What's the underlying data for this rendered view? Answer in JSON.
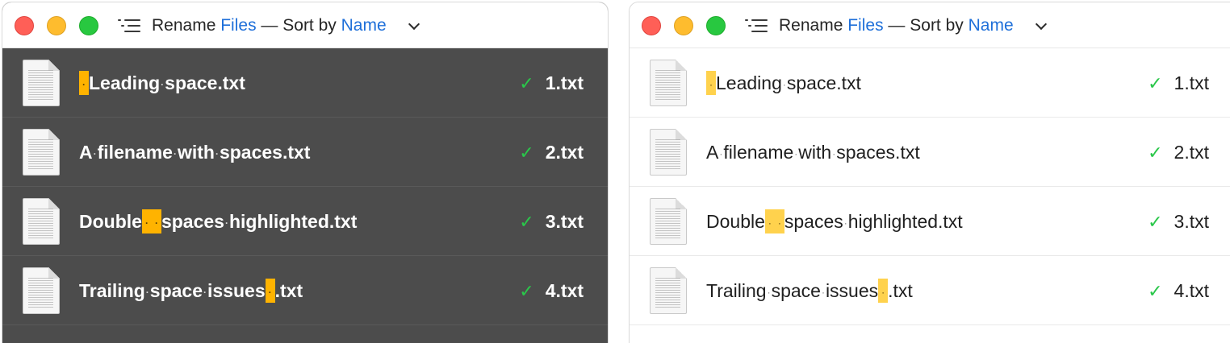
{
  "title": {
    "prefix": "Rename",
    "files": "Files",
    "middle": "— Sort by",
    "name": "Name"
  },
  "colors": {
    "highlight_dark": "#ffb300",
    "highlight_light": "#ffd24d",
    "accent": "#1e6fd9",
    "check": "#2ac74a"
  },
  "rows": [
    {
      "parts": [
        [
          "",
          true
        ],
        [
          "Leading",
          false
        ],
        [
          "",
          false
        ],
        [
          "space.txt",
          false
        ]
      ],
      "result": "1.txt"
    },
    {
      "parts": [
        [
          "A",
          false
        ],
        [
          "",
          false
        ],
        [
          "filename",
          false
        ],
        [
          "",
          false
        ],
        [
          "with",
          false
        ],
        [
          "",
          false
        ],
        [
          "spaces.txt",
          false
        ]
      ],
      "result": "2.txt"
    },
    {
      "parts": [
        [
          "Double",
          false
        ],
        [
          "",
          true
        ],
        [
          "",
          true
        ],
        [
          "spaces",
          false
        ],
        [
          "",
          false
        ],
        [
          "highlighted.txt",
          false
        ]
      ],
      "result": "3.txt"
    },
    {
      "parts": [
        [
          "Trailing",
          false
        ],
        [
          "",
          false
        ],
        [
          "space",
          false
        ],
        [
          "",
          false
        ],
        [
          "issues",
          false
        ],
        [
          "",
          true
        ],
        [
          ".txt",
          false
        ]
      ],
      "result": "4.txt"
    }
  ],
  "check_symbol": "✓"
}
